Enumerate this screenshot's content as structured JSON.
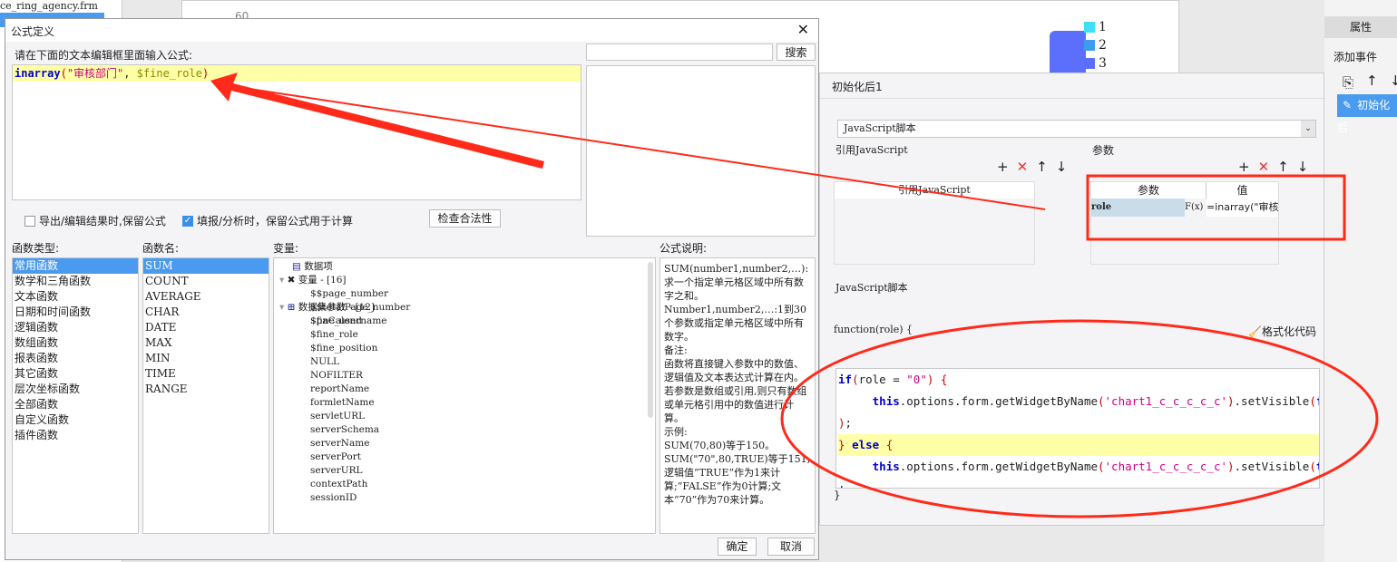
{
  "background": {
    "file_name": "ce_ring_agency.frm",
    "axis_tick": "60",
    "legend": [
      "1",
      "2",
      "3"
    ],
    "props_tab": "属性",
    "add_event": "添加事件",
    "event_item": "初始化后"
  },
  "formula_dialog": {
    "title": "公式定义",
    "instruction": "请在下面的文本编辑框里面输入公式:",
    "formula": {
      "fn": "inarray",
      "open": "(",
      "arg1": "\"审核部门\"",
      "sep": ", ",
      "arg2": "$fine_role",
      "close": ")"
    },
    "search_placeholder": "",
    "search_label": "搜索",
    "option1": {
      "label": "导出/编辑结果时,保留公式",
      "checked": false
    },
    "option2": {
      "label": "填报/分析时，保留公式用于计算",
      "checked": true
    },
    "check_label": "检查合法性",
    "types_label": "函数类型:",
    "names_label": "函数名:",
    "vars_label": "变量:",
    "desc_label": "公式说明:",
    "types": [
      "常用函数",
      "数学和三角函数",
      "文本函数",
      "日期和时间函数",
      "逻辑函数",
      "数组函数",
      "报表函数",
      "其它函数",
      "层次坐标函数",
      "全部函数",
      "自定义函数",
      "插件函数"
    ],
    "names": [
      "SUM",
      "COUNT",
      "AVERAGE",
      "CHAR",
      "DATE",
      "MAX",
      "MIN",
      "TIME",
      "RANGE"
    ],
    "vars": {
      "data_item": "数据项",
      "var_group": "变量 - [16]",
      "vars": [
        "$$page_number",
        "$$totalPage_number",
        "$fine_username",
        "$fine_role",
        "$fine_position",
        "NULL",
        "NOFILTER",
        "reportName",
        "formletName",
        "servletURL",
        "serverSchema",
        "serverName",
        "serverPort",
        "serverURL",
        "contextPath",
        "sessionID"
      ],
      "ds_group": "数据集参数 - [12]",
      "ds_vars": [
        "$paCalend"
      ]
    },
    "description": [
      "SUM(number1,number2,…):求一个指定单元格区域中所有数字之和。",
      "Number1,number2,…:1到30个参数或指定单元格区域中所有数字。",
      "备注:",
      "函数将直接键入参数中的数值、逻辑值及文本表达式计算在内。若参数是数组或引用,则只有数组或单元格引用中的数值进行计算。",
      "示例:",
      "SUM(70,80)等于150。",
      "SUM(\"70\",80,TRUE)等于151,逻辑值“TRUE”作为1来计算;“FALSE”作为0计算;文本“70”作为70来计算。"
    ],
    "ok_label": "确定",
    "cancel_label": "取消"
  },
  "event_panel": {
    "title": "初始化后1",
    "type_select": "JavaScript脚本",
    "ref_js_label": "引用JavaScript",
    "params_label": "参数",
    "ref_js_header": "引用JavaScript",
    "param_col": "参数",
    "value_col": "值",
    "param_row": {
      "name": "role",
      "fx": "F(x)",
      "value": "=inarray(\"审核部门\""
    },
    "script_label": "JavaScript脚本",
    "function_sig": "function(role) {",
    "format_label": "格式化代码",
    "closing": "}",
    "code": [
      [
        [
          "kw",
          "if"
        ],
        [
          "par",
          "("
        ],
        [
          "",
          "role = "
        ],
        [
          "str",
          "\"0\""
        ],
        [
          "par",
          ")"
        ],
        [
          "",
          " "
        ],
        [
          "par",
          "{"
        ]
      ],
      [
        [
          "",
          "     "
        ],
        [
          "kw",
          "this"
        ],
        [
          "",
          ".options.form.getWidgetByName"
        ],
        [
          "par",
          "("
        ],
        [
          "str",
          "'chart1_c_c_c_c_c'"
        ],
        [
          "par",
          ")"
        ],
        [
          "",
          ".setVisible"
        ],
        [
          "par",
          "("
        ],
        [
          "kw",
          "false"
        ]
      ],
      [
        [
          "par",
          ")"
        ],
        [
          "",
          ";"
        ]
      ],
      [
        [
          "par",
          "}"
        ],
        [
          "",
          " "
        ],
        [
          "kw",
          "else"
        ],
        [
          "",
          " "
        ],
        [
          "par",
          "{"
        ]
      ],
      [
        [
          "",
          "     "
        ],
        [
          "kw",
          "this"
        ],
        [
          "",
          ".options.form.getWidgetByName"
        ],
        [
          "par",
          "("
        ],
        [
          "str",
          "'chart1_c_c_c_c_c'"
        ],
        [
          "par",
          ")"
        ],
        [
          "",
          ".setVisible"
        ],
        [
          "par",
          "("
        ],
        [
          "kw",
          "true"
        ],
        [
          "par",
          ")"
        ]
      ],
      [
        [
          "",
          ";"
        ]
      ],
      [
        [
          "par",
          "}"
        ]
      ]
    ]
  },
  "colors": {
    "accent": "#4a9bf0",
    "annotation": "#ff2a1a",
    "highlight": "#ffffa8"
  }
}
